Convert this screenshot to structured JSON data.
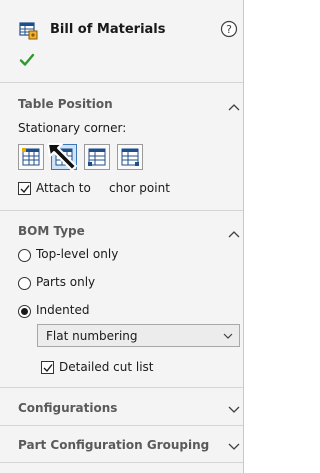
{
  "panel": {
    "title": "Bill of Materials"
  },
  "table_position": {
    "heading": "Table Position",
    "stationary_corner_label": "Stationary corner:",
    "attach_label_part1": "Attach to",
    "attach_label_part2": "chor point",
    "attach_checked": true
  },
  "bom_type": {
    "heading": "BOM Type",
    "options": [
      "Top-level only",
      "Parts only",
      "Indented"
    ],
    "selected": "Indented",
    "numbering_value": "Flat numbering",
    "detailed_cut_list_label": "Detailed cut list",
    "detailed_cut_list_checked": true
  },
  "configurations": {
    "heading": "Configurations"
  },
  "part_configuration_grouping": {
    "heading": "Part Configuration Grouping"
  }
}
